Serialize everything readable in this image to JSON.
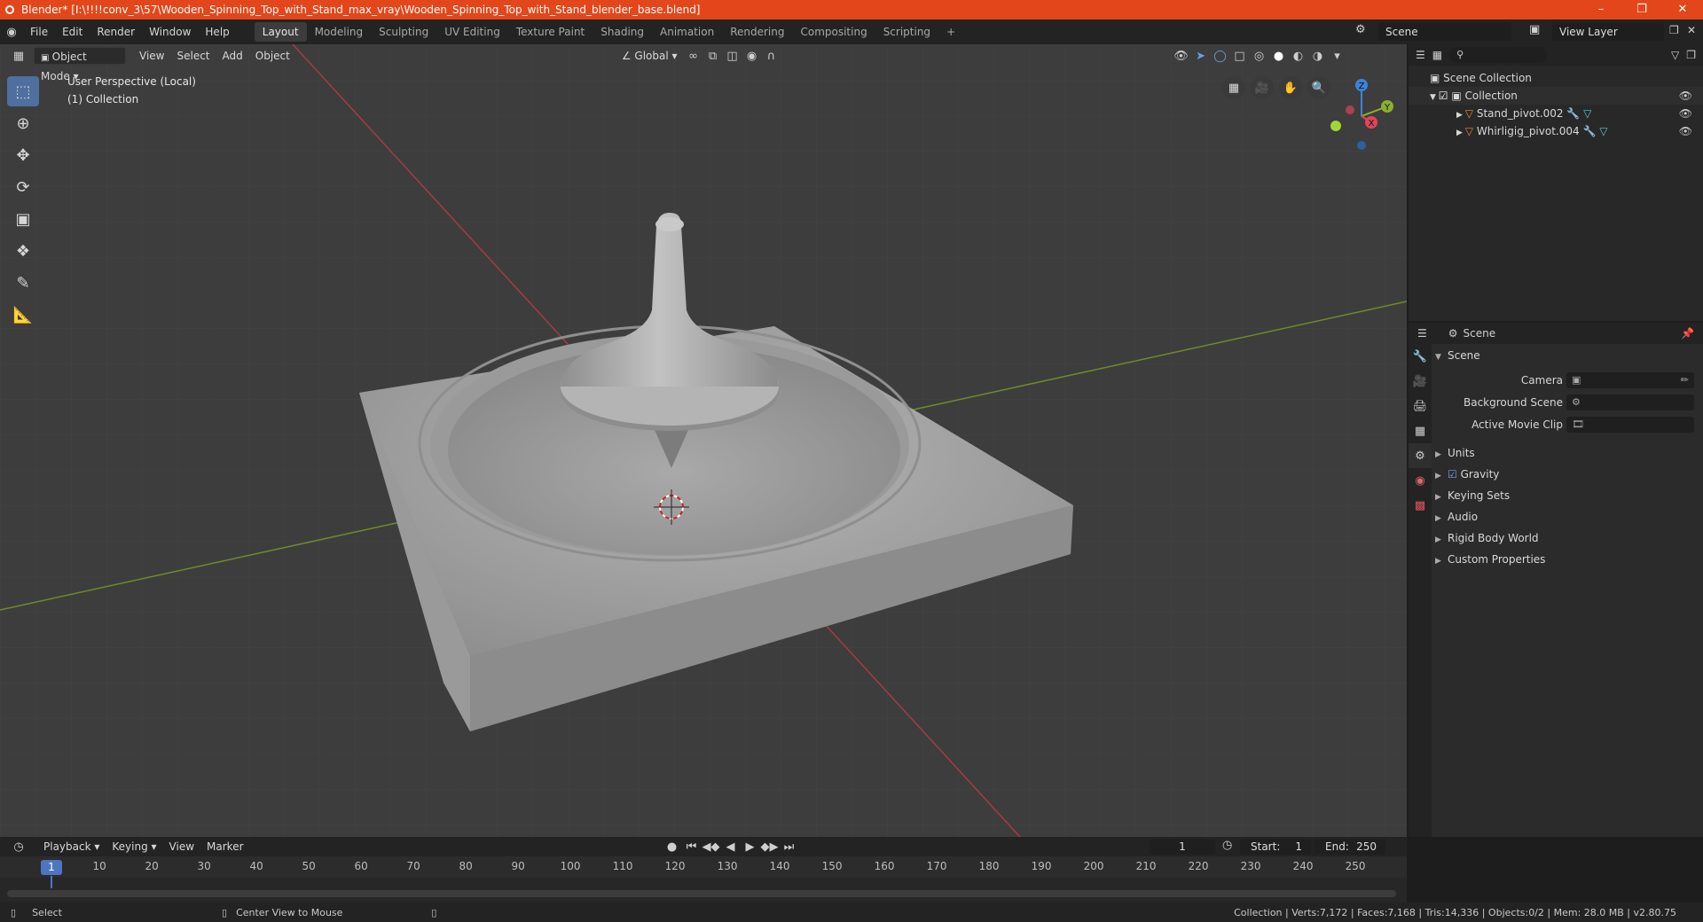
{
  "window": {
    "title": "Blender* [I:\\!!!!conv_3\\57\\Wooden_Spinning_Top_with_Stand_max_vray\\Wooden_Spinning_Top_with_Stand_blender_base.blend]",
    "minimize": "–",
    "maximize": "❐",
    "close": "✕"
  },
  "menu": [
    "File",
    "Edit",
    "Render",
    "Window",
    "Help"
  ],
  "workspaces": [
    "Layout",
    "Modeling",
    "Sculpting",
    "UV Editing",
    "Texture Paint",
    "Shading",
    "Animation",
    "Rendering",
    "Compositing",
    "Scripting",
    "+"
  ],
  "scene_name": "Scene",
  "view_layer": "View Layer",
  "viewport": {
    "mode": "Object Mode",
    "menus": [
      "View",
      "Select",
      "Add",
      "Object"
    ],
    "orientation": "Global",
    "info_line1": "User Perspective (Local)",
    "info_line2": "(1) Collection",
    "gizmo": {
      "z": "Z",
      "y": "Y",
      "x": "X"
    }
  },
  "outliner": {
    "search_placeholder": "",
    "items": [
      "Scene Collection",
      "Collection",
      "Stand_pivot.002",
      "Whirligig_pivot.004"
    ]
  },
  "properties": {
    "header": "Scene",
    "section": "Scene",
    "camera_label": "Camera",
    "bg_label": "Background Scene",
    "clip_label": "Active Movie Clip",
    "panels": [
      "Units",
      "Gravity",
      "Keying Sets",
      "Audio",
      "Rigid Body World",
      "Custom Properties"
    ]
  },
  "timeline": {
    "menus": [
      "Playback",
      "Keying",
      "View",
      "Marker"
    ],
    "current_frame": "1",
    "start_label": "Start:",
    "start": "1",
    "end_label": "End:",
    "end": "250",
    "ticks": [
      "1",
      "10",
      "20",
      "30",
      "40",
      "50",
      "60",
      "70",
      "80",
      "90",
      "100",
      "110",
      "120",
      "130",
      "140",
      "150",
      "160",
      "170",
      "180",
      "190",
      "200",
      "210",
      "220",
      "230",
      "240",
      "250"
    ]
  },
  "status": {
    "select": "Select",
    "center": "Center View to Mouse",
    "stats": "Collection | Verts:7,172 | Faces:7,168 | Tris:14,336 | Objects:0/2 | Mem: 28.0 MB | v2.80.75"
  },
  "colors": {
    "accent": "#e3461a",
    "active_tool": "#4f6f9f",
    "frame": "#4f75c1",
    "x_axis": "#e0455a",
    "y_axis": "#8ab22d",
    "z_axis": "#3f83d8"
  }
}
